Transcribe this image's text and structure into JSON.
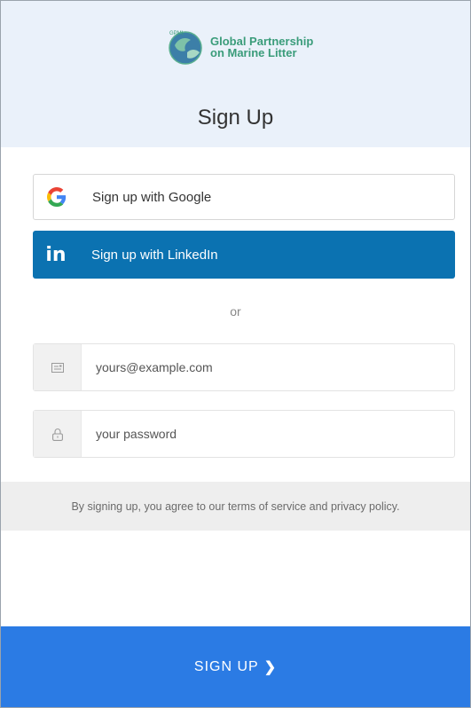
{
  "header": {
    "logo_line1": "Global Partnership",
    "logo_line2": "on Marine Litter",
    "logo_mark_text": "GPML",
    "title": "Sign Up"
  },
  "social": {
    "google_label": "Sign up with Google",
    "linkedin_label": "Sign up with LinkedIn",
    "linkedin_icon_text": "in"
  },
  "divider": {
    "or_label": "or"
  },
  "form": {
    "email": {
      "placeholder": "yours@example.com",
      "value": "",
      "icon": "email-icon"
    },
    "password": {
      "placeholder": "your password",
      "value": "",
      "icon": "lock-icon"
    }
  },
  "terms": {
    "text": "By signing up, you agree to our terms of service and privacy policy."
  },
  "submit": {
    "label": "SIGN UP",
    "chevron": "❯"
  },
  "colors": {
    "header_bg": "#eaf1fa",
    "linkedin_blue": "#0b72b1",
    "submit_blue": "#2b7be4",
    "logo_green": "#3a9c7a"
  }
}
